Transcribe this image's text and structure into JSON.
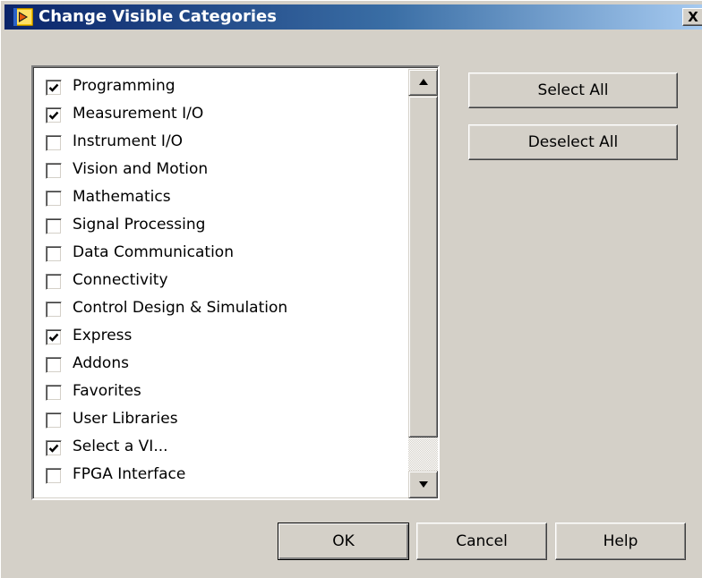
{
  "window": {
    "title": "Change Visible Categories",
    "close_glyph": "X"
  },
  "categories": [
    {
      "label": "Programming",
      "checked": true
    },
    {
      "label": "Measurement I/O",
      "checked": true
    },
    {
      "label": "Instrument I/O",
      "checked": false
    },
    {
      "label": "Vision and Motion",
      "checked": false
    },
    {
      "label": "Mathematics",
      "checked": false
    },
    {
      "label": "Signal Processing",
      "checked": false
    },
    {
      "label": "Data Communication",
      "checked": false
    },
    {
      "label": "Connectivity",
      "checked": false
    },
    {
      "label": "Control Design & Simulation",
      "checked": false
    },
    {
      "label": "Express",
      "checked": true
    },
    {
      "label": "Addons",
      "checked": false
    },
    {
      "label": "Favorites",
      "checked": false
    },
    {
      "label": "User Libraries",
      "checked": false
    },
    {
      "label": "Select a VI...",
      "checked": true
    },
    {
      "label": "FPGA Interface",
      "checked": false
    }
  ],
  "buttons": {
    "select_all": "Select All",
    "deselect_all": "Deselect All",
    "ok": "OK",
    "cancel": "Cancel",
    "help": "Help"
  },
  "icons": {
    "app": "labview-palette-icon",
    "check": "checkmark-icon",
    "scroll_up": "scroll-up-arrow-icon",
    "scroll_down": "scroll-down-arrow-icon",
    "close": "close-icon"
  },
  "colors": {
    "dialog_face": "#d4d0c8",
    "title_gradient_start": "#0a246a",
    "title_gradient_end": "#a6caf0",
    "title_text": "#ffffff",
    "list_background": "#ffffff"
  }
}
